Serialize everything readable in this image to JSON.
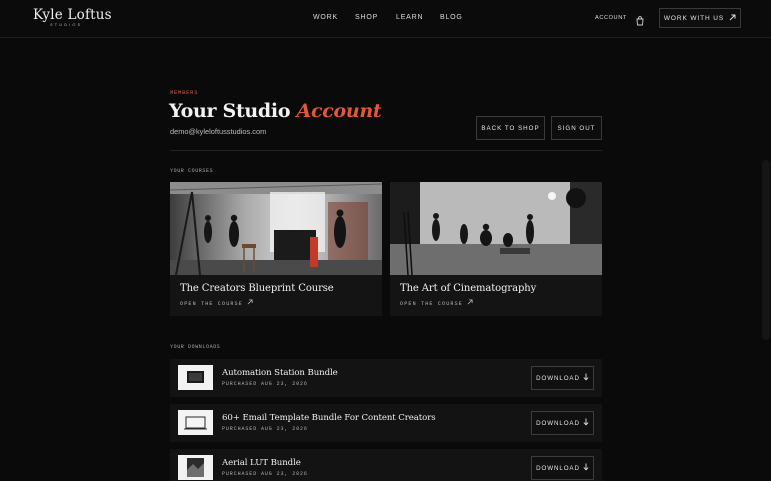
{
  "brand": {
    "name": "Kyle Loftus",
    "sub": "STUDIOS"
  },
  "nav": {
    "links": [
      "WORK",
      "SHOP",
      "LEARN",
      "BLOG"
    ],
    "account": "ACCOUNT",
    "cta": "WORK WITH US"
  },
  "header": {
    "eyebrow": "MEMBERS",
    "title_main": "Your Studio",
    "title_accent": "Account",
    "email": "demo@kyleloftusstudios.com",
    "back_label": "BACK TO SHOP",
    "signout_label": "SIGN OUT"
  },
  "courses": {
    "label": "YOUR COURSES",
    "items": [
      {
        "title": "The Creators Blueprint Course",
        "link": "OPEN THE COURSE"
      },
      {
        "title": "The Art of Cinematography",
        "link": "OPEN THE COURSE"
      }
    ]
  },
  "downloads": {
    "label": "YOUR DOWNLOADS",
    "button_label": "DOWNLOAD",
    "items": [
      {
        "title": "Automation Station Bundle",
        "date": "PURCHASED AUG 23, 2026"
      },
      {
        "title": "60+ Email Template Bundle For Content Creators",
        "date": "PURCHASED AUG 23, 2026"
      },
      {
        "title": "Aerial LUT Bundle",
        "date": "PURCHASED AUG 23, 2026"
      }
    ]
  },
  "colors": {
    "accent": "#e2583d",
    "background": "#0a0a0a",
    "card": "#141414",
    "border": "#3a3a3a"
  },
  "icons": {
    "bag": "shopping-bag-icon",
    "arrow": "arrow-up-right-icon",
    "download": "download-arrow-icon"
  }
}
